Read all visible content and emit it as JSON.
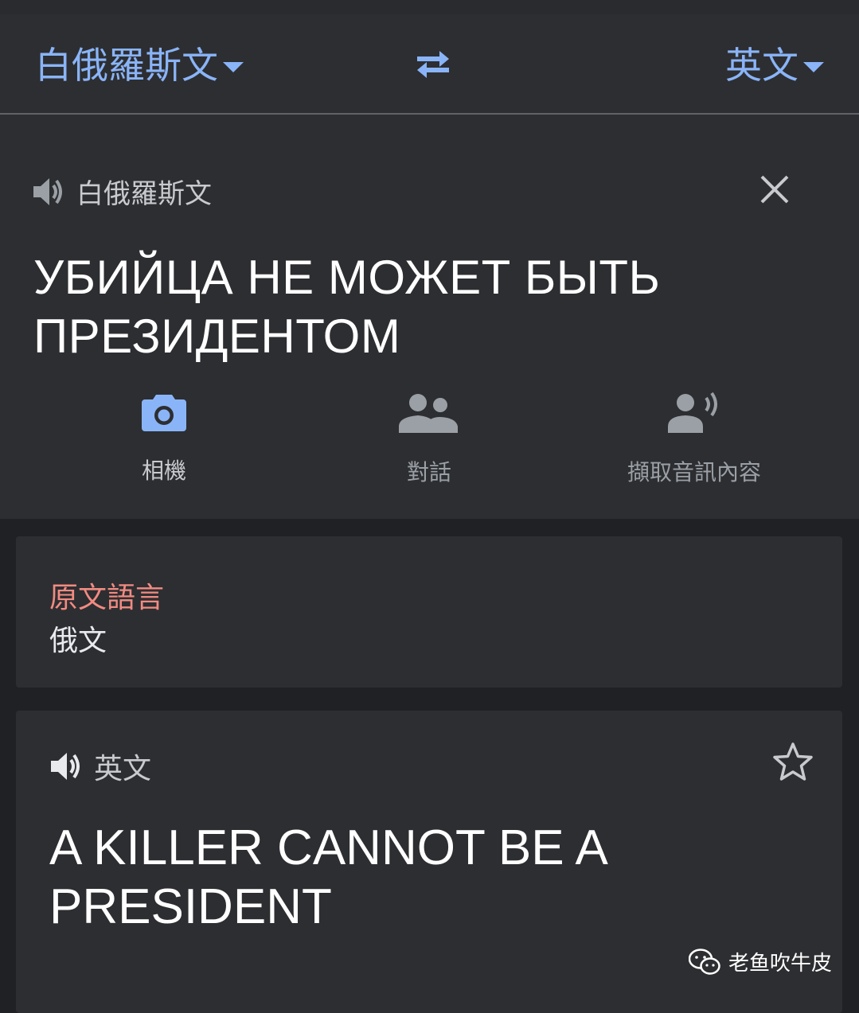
{
  "header": {
    "source_language": "白俄羅斯文",
    "target_language": "英文"
  },
  "input": {
    "language_label": "白俄羅斯文",
    "text_line1": "УБИЙЦА НЕ МОЖЕТ БЫТЬ",
    "text_line2": "ПРЕЗИДЕНТОМ"
  },
  "tools": [
    {
      "label": "相機",
      "icon": "camera-icon",
      "color": "#8ab4f8"
    },
    {
      "label": "對話",
      "icon": "people-icon",
      "color": "#9aa0a6"
    },
    {
      "label": "擷取音訊內容",
      "icon": "transcribe-icon",
      "color": "#9aa0a6"
    }
  ],
  "detected": {
    "title": "原文語言",
    "value": "俄文"
  },
  "output": {
    "language_label": "英文",
    "text_line1": "A KILLER CANNOT BE A",
    "text_line2": "PRESIDENT"
  },
  "watermark": {
    "text": "老鱼吹牛皮"
  },
  "colors": {
    "accent": "#8ab4f8",
    "detected_title": "#f28b82",
    "background": "#202124",
    "panel": "#2d2e31"
  }
}
